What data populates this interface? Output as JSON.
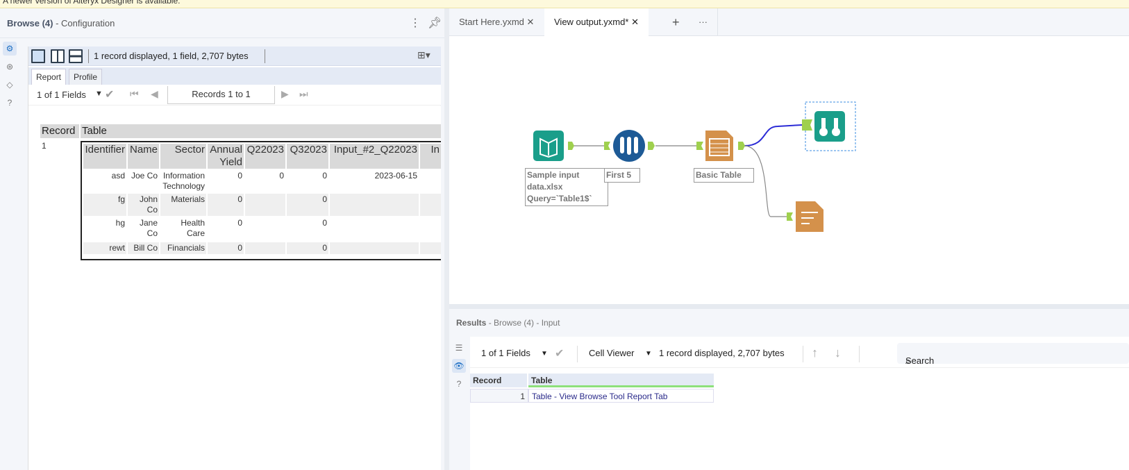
{
  "banner": {
    "text": "A newer version of Alteryx Designer is available."
  },
  "left_panel": {
    "title": "Browse (4)",
    "subtitle": "- Configuration",
    "summary": "1 record displayed, 1 field, 2,707 bytes",
    "tabs": [
      "Report",
      "Profile"
    ],
    "fields_select": "1 of 1 Fields",
    "records_label": "Records 1 to 1",
    "report": {
      "headers": [
        "Record",
        "Table"
      ],
      "record_num": "1",
      "table_columns": [
        "Identifier",
        "Name",
        "Sector",
        "Annual Yield",
        "Q22023",
        "Q32023",
        "Input_#2_Q22023",
        "In"
      ],
      "rows": [
        [
          "asd",
          "Joe Co",
          "Information Technology",
          "0",
          "0",
          "0",
          "2023-06-15",
          ""
        ],
        [
          "fg",
          "John Co",
          "Materials",
          "0",
          "",
          "0",
          "",
          ""
        ],
        [
          "hg",
          "Jane Co",
          "Health Care",
          "0",
          "",
          "0",
          "",
          ""
        ],
        [
          "rewt",
          "Bill Co",
          "Financials",
          "0",
          "",
          "0",
          "",
          ""
        ]
      ]
    }
  },
  "workflow_tabs": [
    {
      "label": "Start Here.yxmd",
      "active": false
    },
    {
      "label": "View output.yxmd*",
      "active": true
    }
  ],
  "nodes": {
    "input": [
      "Sample input",
      "data.xlsx",
      "Query=`Table1$`"
    ],
    "sample": "First 5",
    "table": "Basic Table"
  },
  "colors": {
    "input": "#1a9e8a",
    "sample": "#1d5a96",
    "reporting": "#d4914b",
    "connector": "#9fd04e",
    "selected_wire": "#2b2bd6"
  },
  "results": {
    "title": "Results",
    "subtitle": "- Browse (4) - Input",
    "fields_select": "1 of 1 Fields",
    "viewer": "Cell Viewer",
    "summary": "1 record displayed, 2,707 bytes",
    "search_placeholder": "Search",
    "columns": [
      "Record",
      "Table"
    ],
    "rows": [
      [
        "1",
        "Table - View Browse Tool Report Tab"
      ]
    ]
  }
}
